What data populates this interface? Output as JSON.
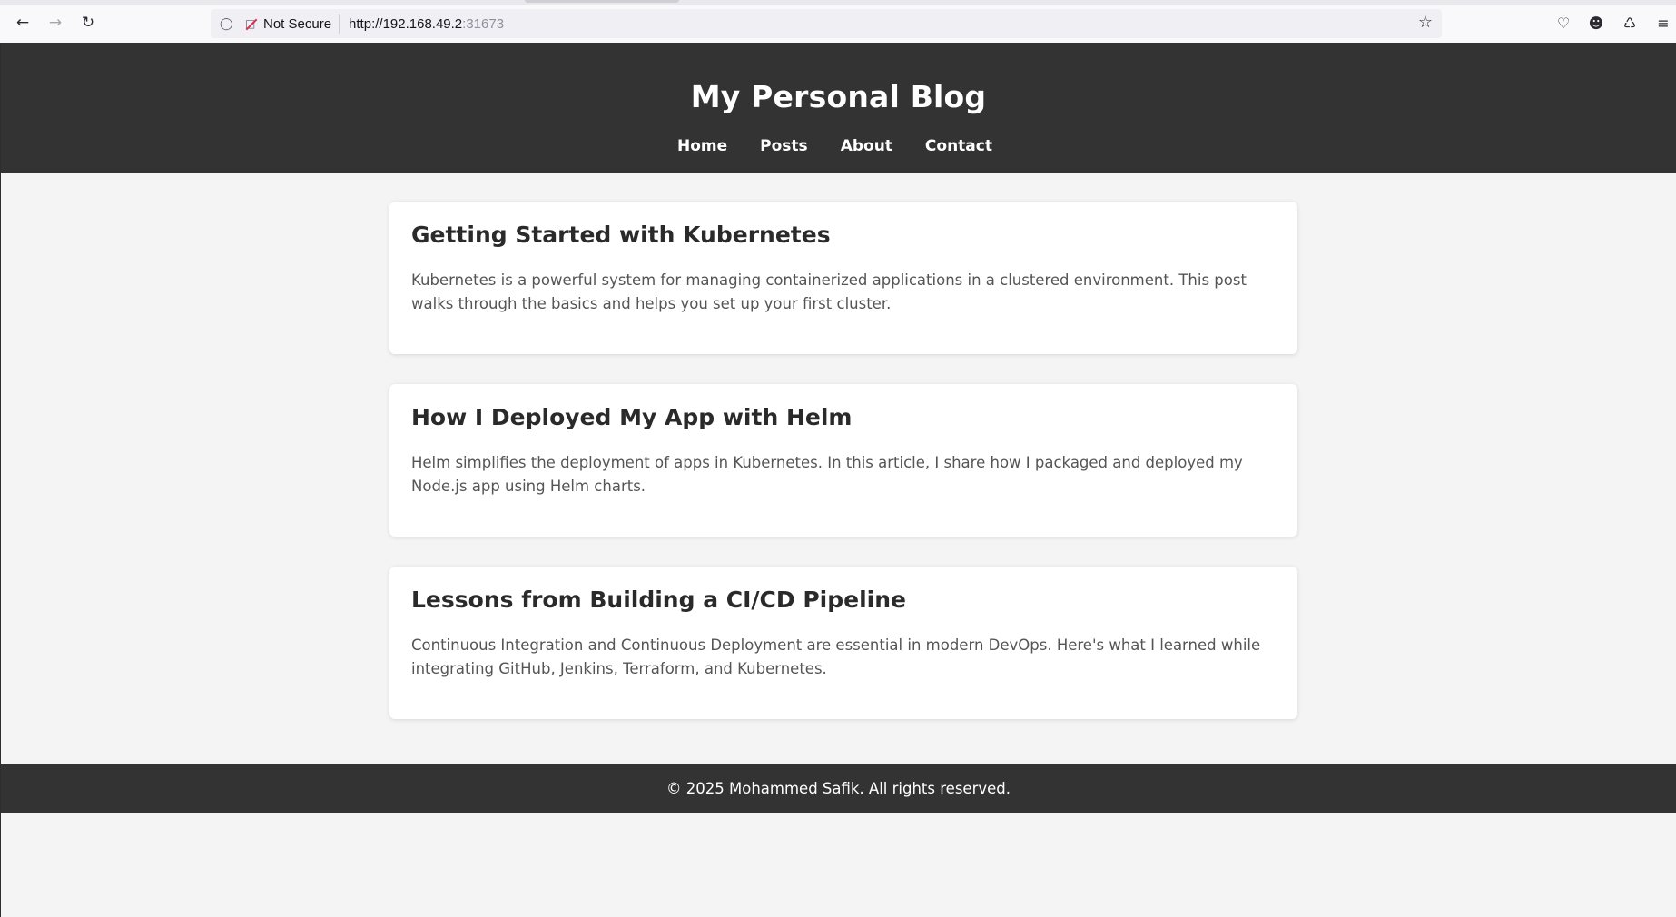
{
  "browser": {
    "security_label": "Not Secure",
    "url_host": "http://192.168.49.2",
    "url_port": ":31673"
  },
  "site": {
    "title": "My Personal Blog",
    "nav": [
      {
        "label": "Home"
      },
      {
        "label": "Posts"
      },
      {
        "label": "About"
      },
      {
        "label": "Contact"
      }
    ]
  },
  "posts": [
    {
      "title": "Getting Started with Kubernetes",
      "excerpt": "Kubernetes is a powerful system for managing containerized applications in a clustered environment. This post walks through the basics and helps you set up your first cluster."
    },
    {
      "title": "How I Deployed My App with Helm",
      "excerpt": "Helm simplifies the deployment of apps in Kubernetes. In this article, I share how I packaged and deployed my Node.js app using Helm charts."
    },
    {
      "title": "Lessons from Building a CI/CD Pipeline",
      "excerpt": "Continuous Integration and Continuous Deployment are essential in modern DevOps. Here's what I learned while integrating GitHub, Jenkins, Terraform, and Kubernetes."
    }
  ],
  "footer": {
    "text": "© 2025 Mohammed Safik. All rights reserved."
  }
}
